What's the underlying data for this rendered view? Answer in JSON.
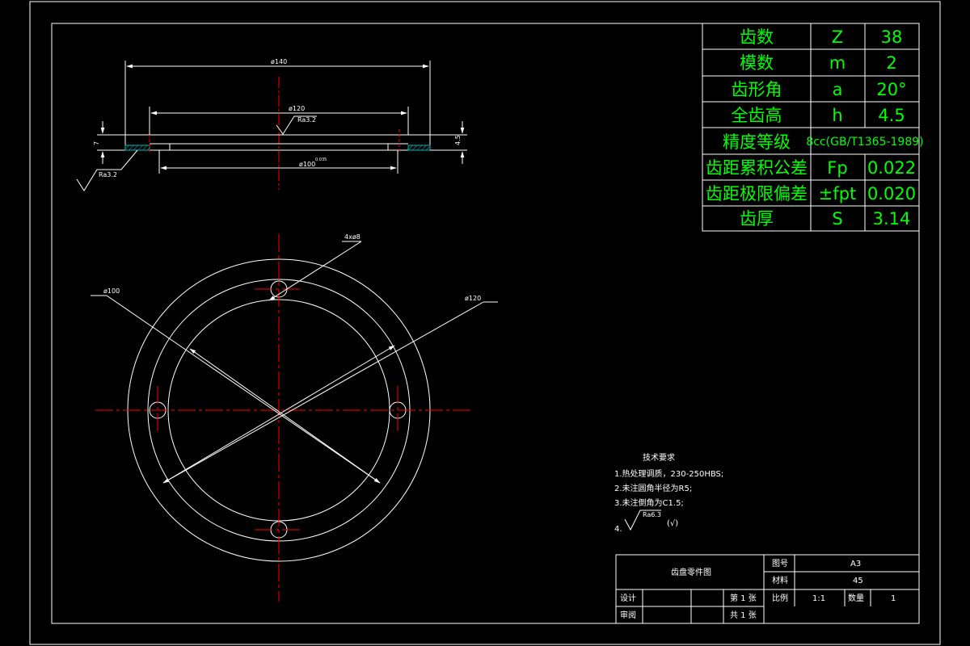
{
  "colors": {
    "background": "#000000",
    "line": "#ffffff",
    "center_line": "#ff0000",
    "table_text": "#00ff00",
    "hatch": "#00bcbc"
  },
  "dimensions": {
    "outer_dia_top": "ø140",
    "inner_dia_top": "ø120",
    "bore_dia_top": "ø100",
    "bore_tol": "0.035",
    "height_left": "7",
    "height_right": "4.5",
    "roughness_top": "Ra3.2",
    "roughness_left": "Ra3.2",
    "holes": "4xø8",
    "circle_left": "ø100",
    "circle_right": "ø120"
  },
  "params": [
    {
      "name": "齿数",
      "symbol": "Z",
      "value": "38"
    },
    {
      "name": "模数",
      "symbol": "m",
      "value": "2"
    },
    {
      "name": "齿形角",
      "symbol": "a",
      "value": "20°"
    },
    {
      "name": "全齿高",
      "symbol": "h",
      "value": "4.5"
    },
    {
      "name": "精度等级",
      "symbol": "8cc(GB/T1365-1989)",
      "value": ""
    },
    {
      "name": "齿距累积公差",
      "symbol": "Fp",
      "value": "0.022"
    },
    {
      "name": "齿距极限偏差",
      "symbol": "±fpt",
      "value": "0.020"
    },
    {
      "name": "齿厚",
      "symbol": "S",
      "value": "3.14"
    }
  ],
  "tech": {
    "title": "技术要求",
    "items": [
      "1.热处理调质，230-250HBS;",
      "2.未注圆角半径为R5;",
      "3.未注倒角为C1.5;",
      "4."
    ],
    "roughness": "Ra6.3",
    "paren": "(√)"
  },
  "title_block": {
    "drawing_name": "齿盘零件图",
    "label_drawing_no": "图号",
    "drawing_no": "A3",
    "label_material": "材料",
    "material": "45",
    "label_design": "设计",
    "label_sheet": "第 1 张",
    "label_scale": "比例",
    "scale": "1:1",
    "label_qty": "数量",
    "qty": "1",
    "label_review": "审阅",
    "label_total": "共 1 张"
  }
}
